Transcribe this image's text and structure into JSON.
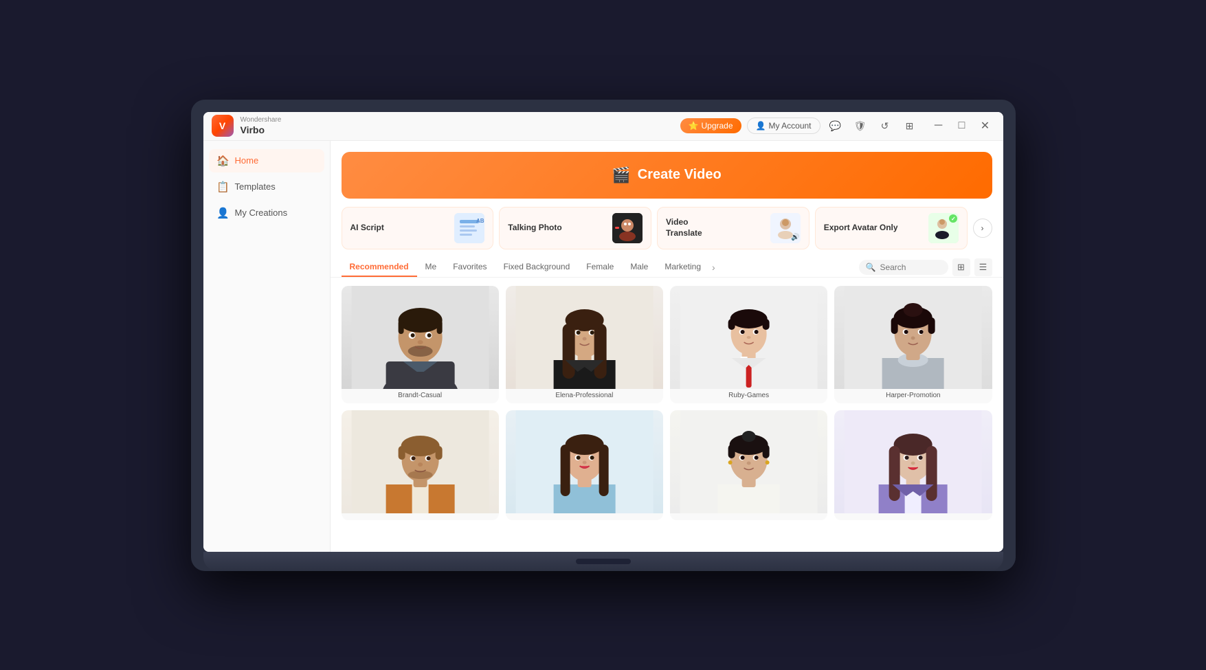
{
  "app": {
    "brand": "Wondershare",
    "name": "Virbo"
  },
  "titlebar": {
    "upgrade_label": "Upgrade",
    "my_account_label": "My Account",
    "icons": [
      "chat",
      "shield",
      "refresh",
      "grid"
    ],
    "window_controls": [
      "─",
      "□",
      "✕"
    ]
  },
  "sidebar": {
    "items": [
      {
        "id": "home",
        "label": "Home",
        "icon": "🏠",
        "active": true
      },
      {
        "id": "templates",
        "label": "Templates",
        "icon": "📋",
        "active": false
      },
      {
        "id": "my-creations",
        "label": "My Creations",
        "icon": "👤",
        "active": false
      }
    ]
  },
  "banner": {
    "label": "Create Video",
    "icon": "🎬"
  },
  "feature_cards": [
    {
      "id": "ai-script",
      "label": "AI Script",
      "thumb_type": "ai"
    },
    {
      "id": "talking-photo",
      "label": "Talking Photo",
      "thumb_type": "photo"
    },
    {
      "id": "video-translate",
      "label": "Video\nTranslate",
      "thumb_type": "translate"
    },
    {
      "id": "export-avatar",
      "label": "Export\nAvatar Only",
      "thumb_type": "avatar"
    }
  ],
  "carousel_arrow": "›",
  "filters": {
    "tabs": [
      {
        "id": "recommended",
        "label": "Recommended",
        "active": true
      },
      {
        "id": "me",
        "label": "Me",
        "active": false
      },
      {
        "id": "favorites",
        "label": "Favorites",
        "active": false
      },
      {
        "id": "fixed-bg",
        "label": "Fixed Background",
        "active": false
      },
      {
        "id": "female",
        "label": "Female",
        "active": false
      },
      {
        "id": "male",
        "label": "Male",
        "active": false
      },
      {
        "id": "marketing",
        "label": "Marketing",
        "active": false
      }
    ],
    "more_icon": "›",
    "search_placeholder": "Search"
  },
  "avatars": [
    {
      "id": "brandt",
      "name": "Brandt-Casual",
      "bg": "brandt",
      "skin": "#c4956a",
      "hair": "#2a1a0a",
      "shirt": "#3a3a42"
    },
    {
      "id": "elena",
      "name": "Elena-Professional",
      "bg": "elena",
      "skin": "#d4a882",
      "hair": "#3a2010",
      "shirt": "#6b4a2a"
    },
    {
      "id": "ruby",
      "name": "Ruby-Games",
      "bg": "ruby",
      "skin": "#e8c0a0",
      "hair": "#1a0a0a",
      "shirt": "#f0f0f0",
      "tie": "#cc2222"
    },
    {
      "id": "harper",
      "name": "Harper-Promotion",
      "bg": "harper",
      "skin": "#d0a888",
      "hair": "#1a0808",
      "shirt": "#b0b8c0"
    },
    {
      "id": "row2a",
      "name": "",
      "bg": "row2a",
      "skin": "#c4956a",
      "hair": "#8b5e30",
      "shirt": "#c87830"
    },
    {
      "id": "row2b",
      "name": "",
      "bg": "row2b",
      "skin": "#e0b090",
      "hair": "#3a2010",
      "shirt": "#90c0d8"
    },
    {
      "id": "row2c",
      "name": "",
      "bg": "row2c",
      "skin": "#d8b090",
      "hair": "#1a1010",
      "shirt": "#f5f5f0"
    },
    {
      "id": "row2d",
      "name": "",
      "bg": "row2d",
      "skin": "#e0c0a8",
      "hair": "#4a2828",
      "shirt": "#9080c8"
    }
  ]
}
